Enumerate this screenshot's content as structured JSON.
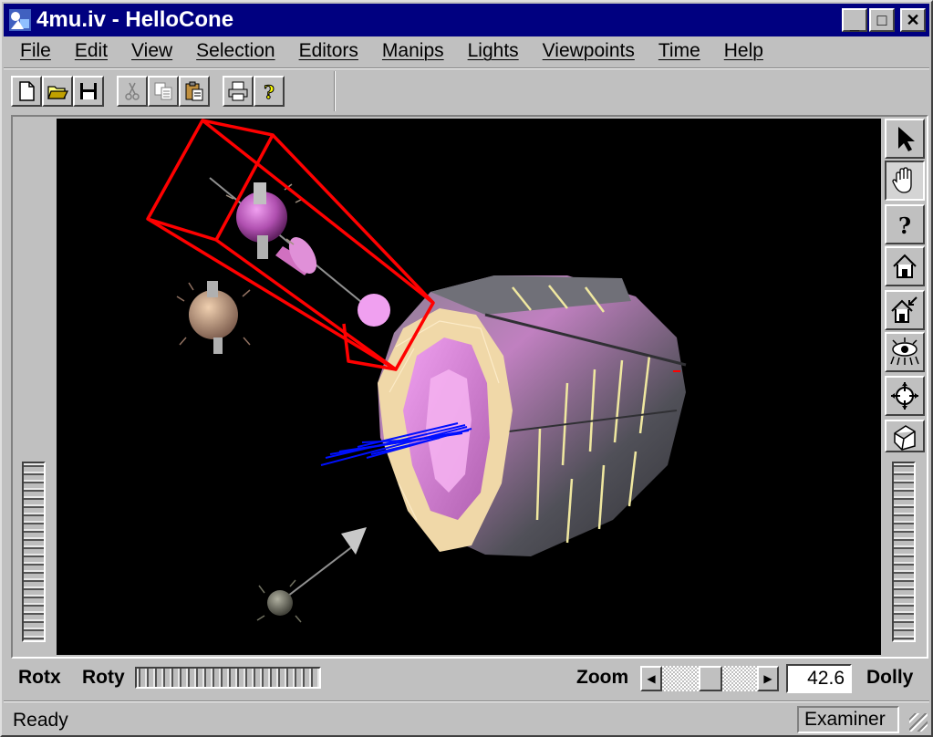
{
  "window": {
    "title": "4mu.iv - HelloCone",
    "minimize_glyph": "_",
    "maximize_glyph": "□",
    "close_glyph": "✕"
  },
  "menu": {
    "items": [
      {
        "label": "File"
      },
      {
        "label": "Edit"
      },
      {
        "label": "View"
      },
      {
        "label": "Selection"
      },
      {
        "label": "Editors"
      },
      {
        "label": "Manips"
      },
      {
        "label": "Lights"
      },
      {
        "label": "Viewpoints"
      },
      {
        "label": "Time"
      },
      {
        "label": "Help"
      }
    ]
  },
  "toolbar": {
    "icons": [
      "new-document-icon",
      "open-folder-icon",
      "save-disk-icon",
      "cut-scissors-icon",
      "copy-icon",
      "paste-clipboard-icon",
      "print-icon",
      "help-question-icon"
    ]
  },
  "viewer": {
    "right_buttons": [
      "select-arrow-icon",
      "hand-view-icon",
      "question-icon",
      "home-icon",
      "set-home-icon",
      "view-all-icon",
      "seek-icon",
      "projection-cube-icon"
    ],
    "active_button": "hand-view-icon"
  },
  "controls": {
    "rotx_label": "Rotx",
    "roty_label": "Roty",
    "zoom_label": "Zoom",
    "zoom_value": "42.6",
    "dolly_label": "Dolly",
    "left_arrow": "◀",
    "right_arrow": "▶"
  },
  "status": {
    "text": "Ready",
    "mode": "Examiner"
  },
  "colors": {
    "titlebar": "#000080",
    "face": "#c0c0c0",
    "viewport_bg": "#000000",
    "manip_box": "#ff0000",
    "tracks": "#0000ff"
  }
}
